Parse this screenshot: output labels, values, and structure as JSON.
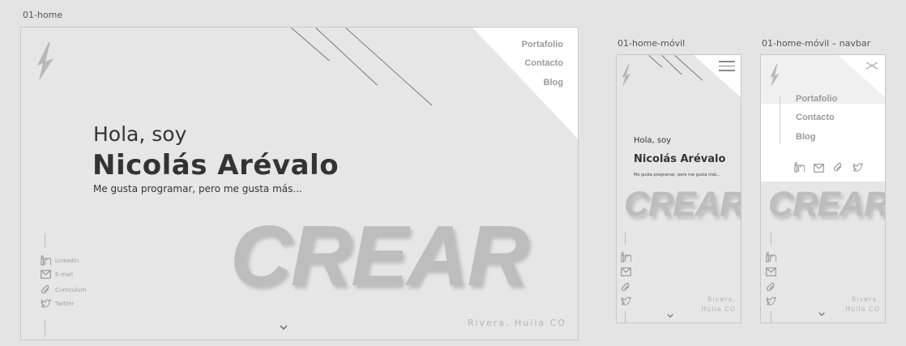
{
  "frames": {
    "desktop_label": "01-home",
    "mobile_label": "01-home-móvil",
    "mobile_nav_label": "01-home-móvil – navbar"
  },
  "nav": {
    "items": [
      {
        "label": "Portafolio"
      },
      {
        "label": "Contacto"
      },
      {
        "label": "Blog"
      }
    ]
  },
  "hero": {
    "greeting": "Hola, soy",
    "name": "Nicolás Arévalo",
    "tagline": "Me gusta programar, pero me gusta más...",
    "big_word": "CREAR"
  },
  "social": {
    "items": [
      {
        "label": "LinkedIn",
        "icon": "linkedin-icon"
      },
      {
        "label": "E-mail",
        "icon": "email-icon"
      },
      {
        "label": "Curriculum",
        "icon": "paperclip-icon"
      },
      {
        "label": "Twitter",
        "icon": "twitter-icon"
      }
    ]
  },
  "location": {
    "desktop": "Rivera, Huila CO",
    "mobile_line1": "Rivera,",
    "mobile_line2": "Huila CO"
  },
  "icons": {
    "logo": "lightning-logo",
    "menu": "hamburger-menu-icon",
    "close": "close-icon",
    "scroll": "chevron-down-icon"
  },
  "colors": {
    "background": "#e4e4e4",
    "artboard": "#e6e6e6",
    "corner": "#ffffff",
    "heading": "#333333",
    "nav": "#9a9a9a",
    "big_word": "#bdbdbd"
  }
}
